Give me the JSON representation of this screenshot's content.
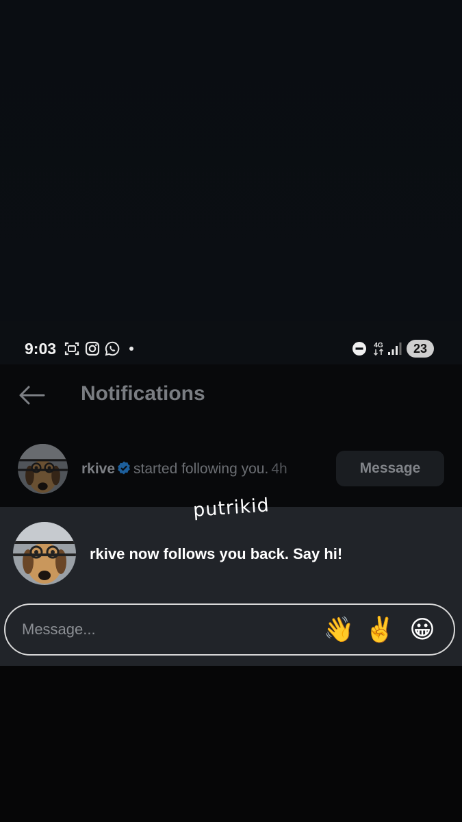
{
  "status_bar": {
    "time": "9:03",
    "left_icons": [
      "screenshot-icon",
      "instagram-icon",
      "whatsapp-icon",
      "notification-dot-icon"
    ],
    "right_icons": [
      "do-not-disturb-icon",
      "network-4g-icon",
      "signal-icon"
    ],
    "network_label": "4G",
    "battery": "23"
  },
  "header": {
    "title": "Notifications",
    "back_icon": "back-arrow-icon"
  },
  "notification": {
    "username": "rkive",
    "verified_icon": "verified-badge-icon",
    "action_text": "started following you.",
    "time": "4h",
    "button_label": "Message"
  },
  "sticker": {
    "text": "putrikid"
  },
  "follow_panel": {
    "text": "rkive now follows you back. Say hi!",
    "input_placeholder": "Message...",
    "emojis": [
      "👋",
      "✌️",
      "😀"
    ]
  },
  "colors": {
    "background": "#0a0c0f",
    "panel": "#212429",
    "verified_blue": "#1d9bf0",
    "dimmed_text": "#7a7d82"
  }
}
